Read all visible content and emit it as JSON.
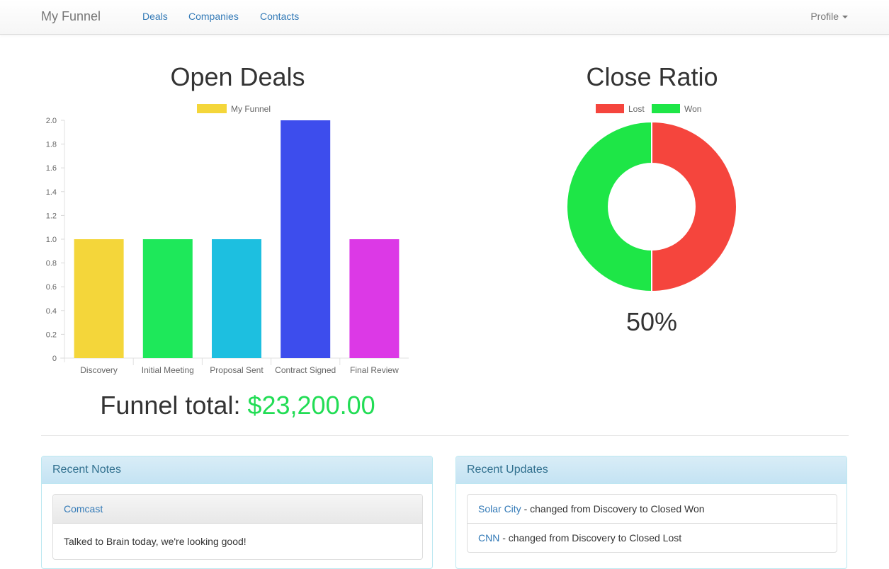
{
  "nav": {
    "brand": "My Funnel",
    "links": [
      "Deals",
      "Companies",
      "Contacts"
    ],
    "profile": "Profile"
  },
  "open_deals": {
    "title": "Open Deals",
    "funnel_total_label": "Funnel total:",
    "funnel_total_value": "$23,200.00"
  },
  "close_ratio": {
    "title": "Close Ratio",
    "value": "50%"
  },
  "chart_data": [
    {
      "type": "bar",
      "legend": [
        "My Funnel"
      ],
      "legend_position": "top",
      "categories": [
        "Discovery",
        "Initial Meeting",
        "Proposal Sent",
        "Contract Signed",
        "Final Review"
      ],
      "series": [
        {
          "name": "My Funnel",
          "values": [
            1,
            1,
            1,
            2,
            1
          ]
        }
      ],
      "colors": [
        "#f4d63a",
        "#1ee85a",
        "#1dbfe0",
        "#3d4ded",
        "#dc39e6"
      ],
      "ylim": [
        0,
        2.0
      ],
      "yticks": [
        "0",
        "0.2",
        "0.4",
        "0.6",
        "0.8",
        "1.0",
        "1.2",
        "1.4",
        "1.6",
        "1.8",
        "2.0"
      ]
    },
    {
      "type": "pie",
      "legend": [
        "Lost",
        "Won"
      ],
      "legend_position": "top",
      "categories": [
        "Lost",
        "Won"
      ],
      "values": [
        1,
        1
      ],
      "colors": [
        "#f5453d",
        "#1ee647"
      ]
    }
  ],
  "recent_notes": {
    "title": "Recent Notes",
    "notes": [
      {
        "company": "Comcast",
        "text": "Talked to Brain today, we're looking good!"
      }
    ]
  },
  "recent_updates": {
    "title": "Recent Updates",
    "items": [
      {
        "company": "Solar City",
        "text": " - changed from Discovery to Closed Won"
      },
      {
        "company": "CNN",
        "text": " - changed from Discovery to Closed Lost"
      }
    ]
  }
}
